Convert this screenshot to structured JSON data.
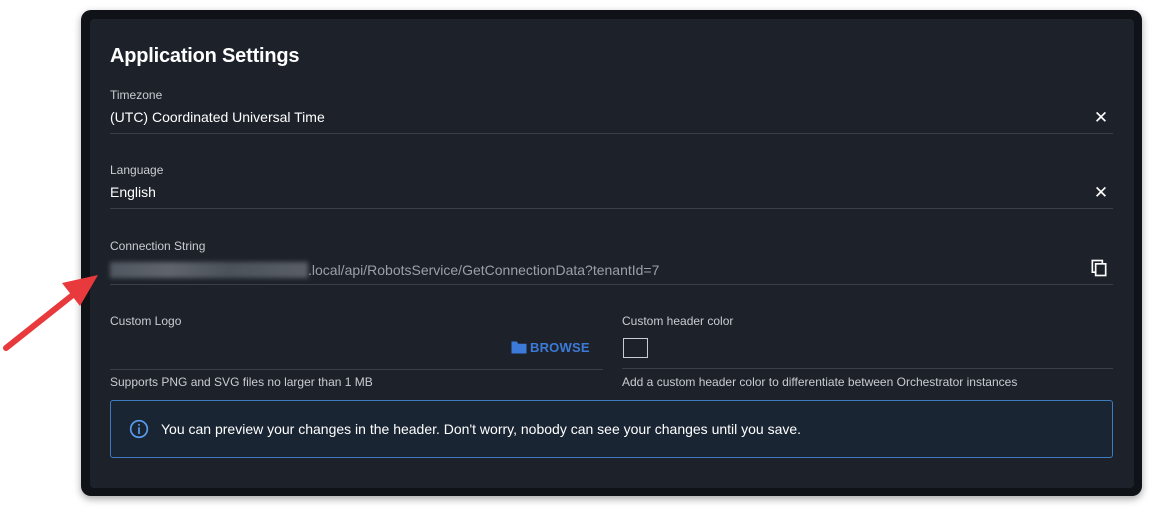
{
  "title": "Application Settings",
  "timezone": {
    "label": "Timezone",
    "value": "(UTC) Coordinated Universal Time"
  },
  "language": {
    "label": "Language",
    "value": "English"
  },
  "connection_string": {
    "label": "Connection String",
    "visible_value": ".local/api/RobotsService/GetConnectionData?tenantId=7"
  },
  "custom_logo": {
    "label": "Custom Logo",
    "browse_label": "BROWSE",
    "helper": "Supports PNG and SVG files no larger than 1 MB"
  },
  "custom_header_color": {
    "label": "Custom header color",
    "helper": "Add a custom header color to differentiate between Orchestrator instances"
  },
  "info": {
    "text": "You can preview your changes in the header. Don't worry, nobody can see your changes until you save."
  },
  "icons": {
    "clear": "close-icon",
    "copy": "copy-icon",
    "folder": "folder-icon",
    "info": "info-icon",
    "annotation": "arrow-annotation"
  },
  "colors": {
    "background": "#1d222a",
    "accent": "#3b7ad9",
    "info_border": "#3e7bbf",
    "arrow": "#e8393c"
  }
}
